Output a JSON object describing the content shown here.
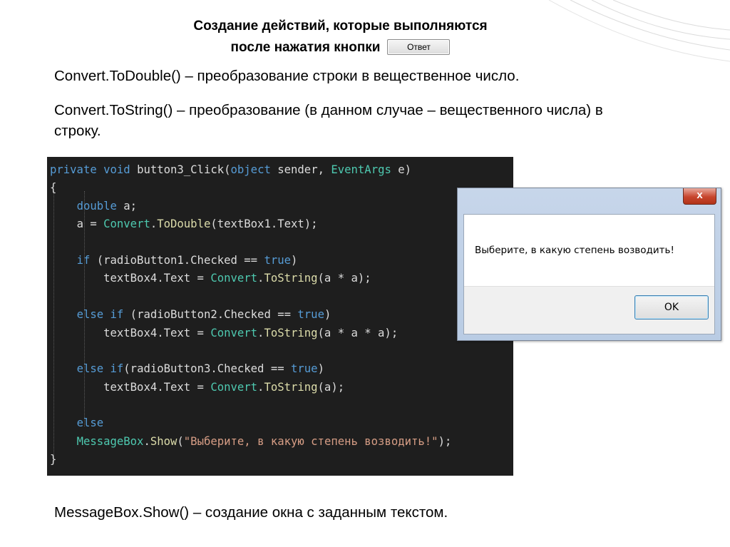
{
  "title": {
    "line1": "Создание действий, которые выполняются",
    "line2": "после нажатия кнопки",
    "button_label": "Ответ"
  },
  "paragraphs": {
    "p1": "Convert.ToDouble() – преобразование строки в вещественное число.",
    "p2_line1": "Convert.ToString() – преобразование (в данном случае – вещественного числа) в",
    "p2_line2": "строку.",
    "p3": "MessageBox.Show() – создание окна с заданным текстом."
  },
  "code": {
    "l1": [
      "private",
      " ",
      "void",
      " ",
      "button3_Click",
      "(",
      "object",
      " sender, ",
      "EventArgs",
      " e)"
    ],
    "l2": "{",
    "l3": [
      "double",
      " a;"
    ],
    "l4": [
      "a = ",
      "Convert",
      ".",
      "ToDouble",
      "(textBox1.Text);"
    ],
    "l6": [
      "if",
      " (radioButton1.Checked == ",
      "true",
      ")"
    ],
    "l7": [
      "textBox4.Text = ",
      "Convert",
      ".",
      "ToString",
      "(a * a);"
    ],
    "l9": [
      "else",
      " ",
      "if",
      " (radioButton2.Checked == ",
      "true",
      ")"
    ],
    "l10": [
      "textBox4.Text = ",
      "Convert",
      ".",
      "ToString",
      "(a * a * a);"
    ],
    "l12": [
      "else",
      " ",
      "if",
      "(radioButton3.Checked == ",
      "true",
      ")"
    ],
    "l13": [
      "textBox4.Text = ",
      "Convert",
      ".",
      "ToString",
      "(a);"
    ],
    "l15": "else",
    "l16": [
      "MessageBox",
      ".",
      "Show",
      "(",
      "\"Выберите, в какую степень возводить!\"",
      ");"
    ],
    "l17": "}"
  },
  "dialog": {
    "close_label": "x",
    "message": "Выберите, в какую степень возводить!",
    "ok_label": "OK"
  }
}
